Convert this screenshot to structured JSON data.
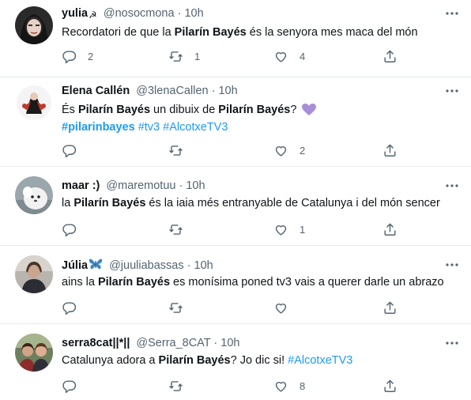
{
  "tweets": [
    {
      "name": "yulia",
      "name_emoji": "☭",
      "handle": "@nosocmona",
      "sep": "·",
      "time": "10h",
      "body": [
        {
          "t": "Recordatori de que la ",
          "s": "plain"
        },
        {
          "t": "Pilarín Bayés",
          "s": "bold"
        },
        {
          "t": " és la senyora mes maca del món",
          "s": "plain"
        }
      ],
      "replies": "2",
      "retweets": "1",
      "likes": "4"
    },
    {
      "name": "Elena Callén",
      "name_emoji": "",
      "handle": "@3lenaCallen",
      "sep": "·",
      "time": "10h",
      "body": [
        {
          "t": "És ",
          "s": "plain"
        },
        {
          "t": "Pilarín Bayés",
          "s": "bold"
        },
        {
          "t": " un dibuix de ",
          "s": "plain"
        },
        {
          "t": "Pilarín Bayés",
          "s": "bold"
        },
        {
          "t": "? ",
          "s": "plain"
        },
        {
          "t": "💜",
          "s": "heart"
        },
        {
          "t": "\n",
          "s": "br"
        },
        {
          "t": "#pilarinbayes",
          "s": "tagbold"
        },
        {
          "t": " ",
          "s": "plain"
        },
        {
          "t": "#tv3",
          "s": "tag"
        },
        {
          "t": " ",
          "s": "plain"
        },
        {
          "t": "#AlcotxeTV3",
          "s": "tag"
        }
      ],
      "replies": "",
      "retweets": "",
      "likes": "2"
    },
    {
      "name": "maar :)",
      "name_emoji": "",
      "handle": "@maremotuu",
      "sep": "·",
      "time": "10h",
      "body": [
        {
          "t": "la ",
          "s": "plain"
        },
        {
          "t": "Pilarín Bayés",
          "s": "bold"
        },
        {
          "t": " és la iaia més entranyable de Catalunya i del món sencer",
          "s": "plain"
        }
      ],
      "replies": "",
      "retweets": "",
      "likes": "1"
    },
    {
      "name": "Júlia",
      "name_emoji": "🦋",
      "handle": "@juuliabassas",
      "sep": "·",
      "time": "10h",
      "body": [
        {
          "t": "ains la ",
          "s": "plain"
        },
        {
          "t": "Pilarín Bayés",
          "s": "bold"
        },
        {
          "t": " es monísima poned tv3 vais a querer darle un abrazo",
          "s": "plain"
        }
      ],
      "replies": "",
      "retweets": "",
      "likes": ""
    },
    {
      "name": "serra8cat||*||",
      "name_emoji": "",
      "handle": "@Serra_8CAT",
      "sep": "·",
      "time": "10h",
      "body": [
        {
          "t": "Catalunya adora a ",
          "s": "plain"
        },
        {
          "t": "Pilarín Bayés",
          "s": "bold"
        },
        {
          "t": "? Jo dic si! ",
          "s": "plain"
        },
        {
          "t": "#AlcotxeTV3",
          "s": "tag"
        }
      ],
      "replies": "",
      "retweets": "",
      "likes": "8"
    }
  ],
  "colors": {
    "text": "#0f1419",
    "secondary": "#536471",
    "link": "#1d9bf0",
    "divider": "#e6ecf0"
  },
  "icons": [
    "reply-icon",
    "retweet-icon",
    "like-icon",
    "share-icon",
    "more-icon"
  ]
}
